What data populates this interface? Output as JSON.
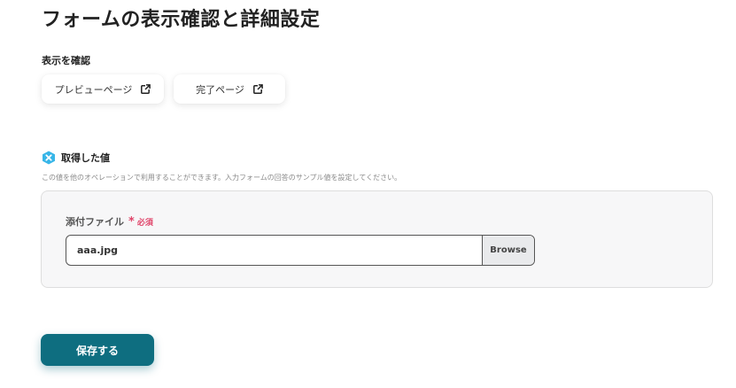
{
  "page": {
    "title": "フォームの表示確認と詳細設定"
  },
  "display_check": {
    "label": "表示を確認",
    "buttons": [
      {
        "label": "プレビューページ",
        "icon": "external-link-icon"
      },
      {
        "label": "完了ページ",
        "icon": "external-link-icon"
      }
    ]
  },
  "acquired_values": {
    "title": "取得した値",
    "icon": "value-hexagon-icon",
    "icon_color": "#38b6e8",
    "description": "この値を他のオペレーションで利用することができます。入力フォームの回答のサンプル値を設定してください。"
  },
  "attachment_field": {
    "label": "添付ファイル",
    "required_mark": "*",
    "required_text": "必須",
    "value": "aaa.jpg",
    "browse_label": "Browse"
  },
  "save": {
    "label": "保存する",
    "color": "#0e6e80"
  }
}
